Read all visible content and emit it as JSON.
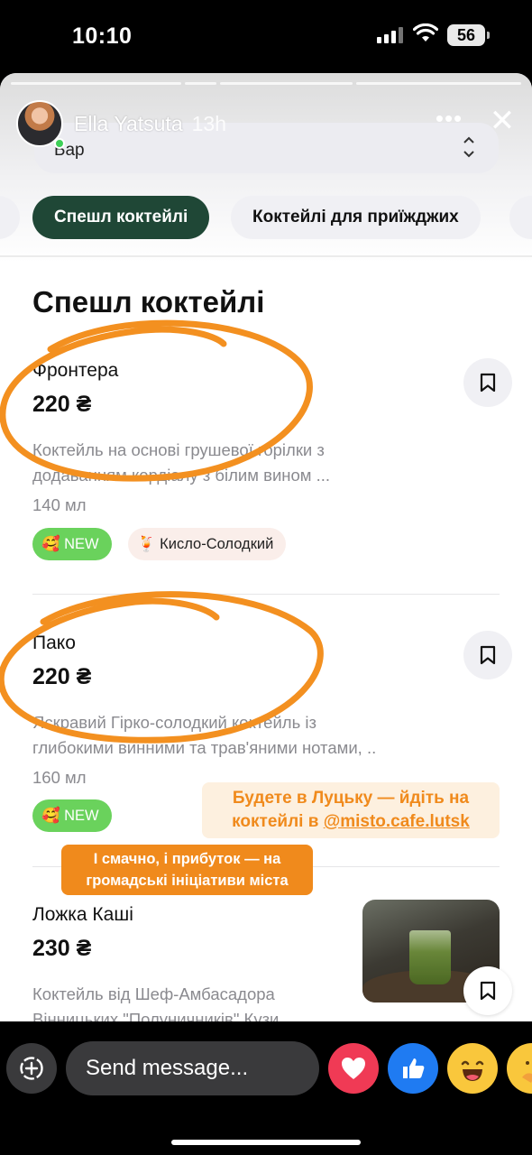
{
  "status_bar": {
    "time": "10:10",
    "battery": "56"
  },
  "story": {
    "author_name": "Ella  Yatsuta",
    "time_ago": "13h",
    "more_label": "•••",
    "close_label": "✕"
  },
  "menu": {
    "selector_label": "Бар",
    "selector_arrows": "⌃\n⌄",
    "chips": [
      "Спешл коктейлі",
      "Коктейлі для приїжджих"
    ],
    "section_title": "Спешл коктейлі",
    "items": [
      {
        "name": "Фронтера",
        "price": "220 ₴",
        "description": "Коктейль на основі грушевої горілки з додаванням кордіалу з білим вином ...",
        "volume": "140 мл",
        "tags": [
          {
            "emoji": "🥰",
            "label": "NEW"
          },
          {
            "emoji": "🍹",
            "label": "Кисло-Солодкий"
          }
        ]
      },
      {
        "name": "Пако",
        "price": "220 ₴",
        "description": "Яскравий Гірко-солодкий коктейль із глибокими винними та трав'яними нотами, ..",
        "volume": "160 мл",
        "tags": [
          {
            "emoji": "🥰",
            "label": "NEW"
          }
        ]
      },
      {
        "name": "Ложка Каші",
        "price": "230 ₴",
        "description": "Коктейль від Шеф-Амбасадора Вінницьких \"Полуничників\" Кузи..."
      }
    ]
  },
  "overlays": {
    "sticker_line1": "Будете в Луцьку — йдіть на",
    "sticker_line2_prefix": "коктейлі в ",
    "sticker_handle": "@misto.cafe.lutsk",
    "orange_line1": "І смачно, і прибуток — на",
    "orange_line2": "громадські ініціативи міста",
    "circle_color": "#f39020"
  },
  "composer": {
    "placeholder": "Send message...",
    "reactions": [
      "heart",
      "like",
      "laugh",
      "hug"
    ]
  }
}
